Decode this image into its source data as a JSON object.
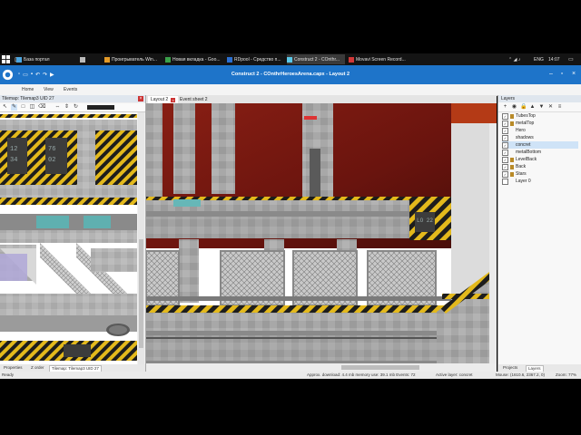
{
  "taskbar": {
    "items": [
      {
        "label": "База портал"
      },
      {
        "label": "Проигрыватель Win..."
      },
      {
        "label": "Новая вкладка - Goo..."
      },
      {
        "label": "RDpool - Средство п..."
      },
      {
        "label": "Construct 2 - COnthr..."
      },
      {
        "label": "Movavi Screen Record..."
      }
    ],
    "lang": "ENG",
    "clock": "14:07"
  },
  "window": {
    "title": "Construct 2 - COnthrHeroesArena.capx - Layout 2"
  },
  "ribbon": {
    "tabs": [
      "Home",
      "View",
      "Events"
    ]
  },
  "left_panel": {
    "title": "Tilemap: Tilemap3 UID 27",
    "bottom_tabs": [
      "Properties",
      "Z order",
      "Tilemap: Tilemap3 UID 27"
    ],
    "tile_labels": [
      "12",
      "76",
      "34",
      "02"
    ]
  },
  "doc_tabs": [
    {
      "label": "Layout 2",
      "active": true
    },
    {
      "label": "Event sheet 2",
      "active": false
    }
  ],
  "canvas": {
    "sign_label": "LO 22"
  },
  "layers_panel": {
    "title": "Layers",
    "layers": [
      {
        "name": "TubesTop",
        "checked": true,
        "locked": true,
        "selected": false
      },
      {
        "name": "metalTop",
        "checked": true,
        "locked": true,
        "selected": false
      },
      {
        "name": "Hero",
        "checked": true,
        "locked": false,
        "selected": false
      },
      {
        "name": "shadows",
        "checked": true,
        "locked": false,
        "selected": false
      },
      {
        "name": "concret",
        "checked": true,
        "locked": false,
        "selected": true
      },
      {
        "name": "metalBottom",
        "checked": true,
        "locked": false,
        "selected": false
      },
      {
        "name": "LevelBack",
        "checked": true,
        "locked": true,
        "selected": false
      },
      {
        "name": "Back",
        "checked": true,
        "locked": true,
        "selected": false
      },
      {
        "name": "Stars",
        "checked": true,
        "locked": true,
        "selected": false
      },
      {
        "name": "Layer 0",
        "checked": false,
        "locked": false,
        "selected": false
      }
    ],
    "bottom_tabs": [
      "Projects",
      "Layers"
    ]
  },
  "status": {
    "ready": "Ready",
    "download": "Approx. download: 4.4 mb  memory use: 39.1 mb  Events: 72",
    "active_layer": "Active layer: concret",
    "mouse": "Mouse: (1610.6, 2367.2, 0)",
    "zoom": "Zoom: 77%"
  },
  "colors": {
    "accent": "#1e74c9",
    "hazard_yellow": "#e3b91c",
    "sky_red": "#7a1c12"
  }
}
